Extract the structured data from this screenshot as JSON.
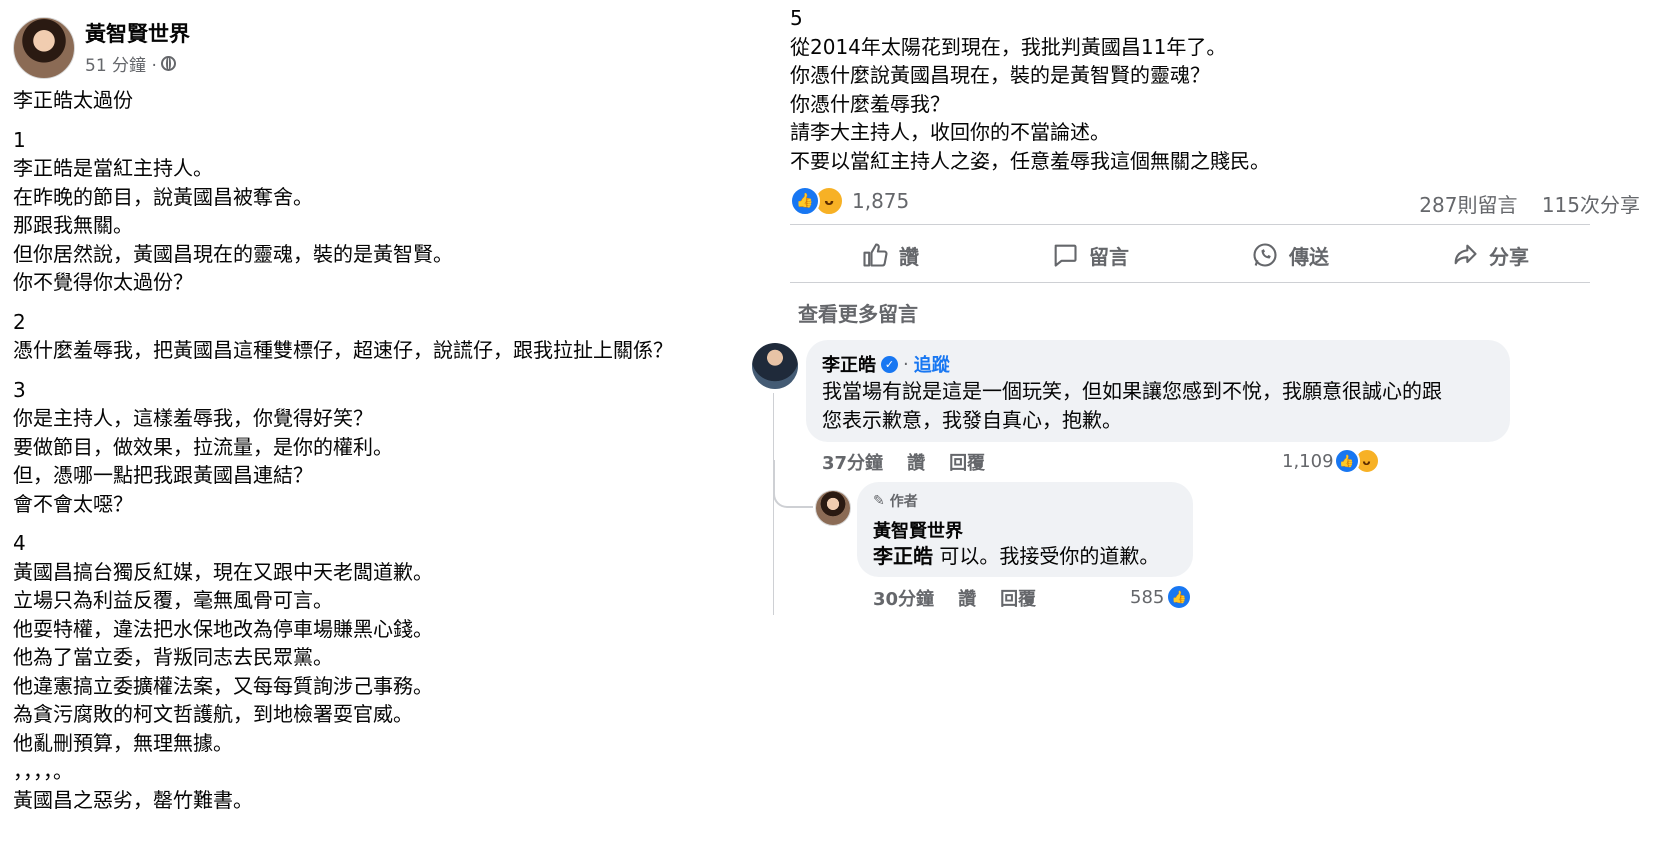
{
  "post": {
    "page_name": "黃智賢世界",
    "time": "51 分鐘 ·",
    "title": "李正皓太過份",
    "paragraphs_left": [
      [
        "1",
        "李正皓是當紅主持人。",
        "在昨晚的節目，說黃國昌被奪舍。",
        "那跟我無關。",
        "但你居然說，黃國昌現在的靈魂，裝的是黃智賢。",
        "你不覺得你太過份？"
      ],
      [
        "2",
        "憑什麼羞辱我，把黃國昌這種雙標仔，超速仔，說謊仔，跟我拉扯上關係？"
      ],
      [
        "3",
        "你是主持人，這樣羞辱我，你覺得好笑？",
        "要做節目，做效果，拉流量，是你的權利。",
        "但，憑哪一點把我跟黃國昌連結？",
        "會不會太噁？"
      ],
      [
        "4",
        "黃國昌搞台獨反紅媒，現在又跟中天老闆道歉。",
        "立場只為利益反覆，毫無風骨可言。",
        "他耍特權，違法把水保地改為停車場賺黑心錢。",
        "他為了當立委，背叛同志去民眾黨。",
        "他違憲搞立委擴權法案，又每每質詢涉己事務。",
        "為貪污腐敗的柯文哲護航，到地檢署耍官威。",
        "他亂刪預算，無理無據。",
        "，，，，。",
        "黃國昌之惡劣，罄竹難書。"
      ]
    ],
    "paragraph_right": [
      "5",
      "從2014年太陽花到現在，我批判黃國昌11年了。",
      "你憑什麼說黃國昌現在，裝的是黃智賢的靈魂？",
      "你憑什麼羞辱我？",
      "請李大主持人，收回你的不當論述。",
      "不要以當紅主持人之姿，任意羞辱我這個無關之賤民。"
    ],
    "reaction_count": "1,875",
    "comments_count": "287則留言",
    "shares_count": "115次分享"
  },
  "actions": {
    "like": "讚",
    "comment": "留言",
    "send": "傳送",
    "share": "分享"
  },
  "see_more": "查看更多留言",
  "comments": [
    {
      "name": "李正皓",
      "follow": "追蹤",
      "text_lines": [
        "我當場有說是這是一個玩笑，但如果讓您感到不悅，我願意很誠心的跟",
        "您表示歉意，我發自真心，抱歉。"
      ],
      "time": "37分鐘",
      "like": "讚",
      "reply": "回覆",
      "reactions": "1,109"
    },
    {
      "author_badge": "作者",
      "name": "黃智賢世界",
      "mention": "李正皓",
      "text": " 可以。我接受你的道歉。",
      "time": "30分鐘",
      "like": "讚",
      "reply": "回覆",
      "reactions": "585"
    }
  ]
}
